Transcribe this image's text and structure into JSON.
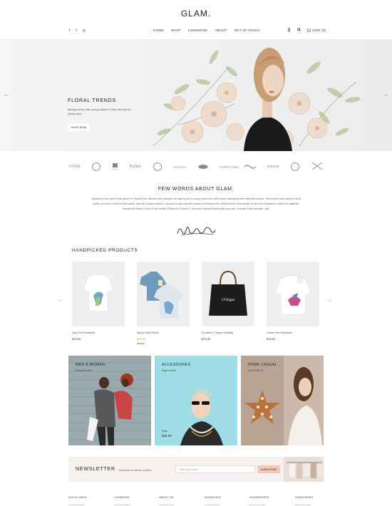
{
  "brand": {
    "logo": "GLAM."
  },
  "social": [
    {
      "icon": "facebook-icon",
      "glyph": "f"
    },
    {
      "icon": "twitter-icon",
      "glyph": "t"
    },
    {
      "icon": "instagram-icon",
      "glyph": "◎"
    }
  ],
  "nav": [
    "HOME",
    "SHOP",
    "LOOKBOOK",
    "ABOUT",
    "GET IN TOUCH"
  ],
  "header_icons": {
    "user_icon": "user-icon",
    "search_icon": "search-icon",
    "cart_label": "CART (0)"
  },
  "hero": {
    "title": "FLORAL TRENDS",
    "text": "Boutique at the 19th-century cloister in Paris' left bank for Spring show",
    "button": "SHOP NOW",
    "prev": "←",
    "next": "→"
  },
  "brands": [
    "FORM",
    "",
    "Alva",
    "foxter",
    "",
    "PAPERS",
    "",
    "PORTLAND",
    "",
    "moose",
    "",
    ""
  ],
  "about": {
    "title": "FEW WORDS ABOUT GLAM.",
    "text": "Optimism is the name of the game for Resort 2016. Almost every designer we saw turned to sunny colors and outfit whose calculating their millennial lineups. There were many spins on floral prints, punches of '80s-era lime green, and lots of glam touches. Occasion to also say this season at Christian Dior, Maria Grazia Chiuri swept us off to the Southwest, while Karl Lagerfeld brought the Resort Cruise to the middle of Paris for Chanel 17 and when the lead Aussie gets you over, consider those beautiful, wild.",
    "signature": "Nella Stayner"
  },
  "products": {
    "title": "HANDPICKED PRODUCTS",
    "prev": "←",
    "next": "→",
    "items": [
      {
        "name": "Dog-Print Sweatshirt",
        "price": "$78.00",
        "old_price": ""
      },
      {
        "name": "Spring Green Wave",
        "price": "$48.00",
        "old_price": "$58.00"
      },
      {
        "name": "Exclusive L'Origan Handbag",
        "price": "$79.00",
        "old_price": ""
      },
      {
        "name": "Goose Print Sweatshirt",
        "price": "$78.00",
        "old_price": ""
      }
    ]
  },
  "categories": [
    {
      "title": "MEN & WOMEN",
      "sub": "Summer outfit",
      "from": "",
      "price": ""
    },
    {
      "title": "ACCESSORIES",
      "sub": "Huge choice",
      "from": "From",
      "price": "$25.00"
    },
    {
      "title": "HOME CASUAL",
      "sub": "Up to 30% off",
      "from": "",
      "price": ""
    }
  ],
  "newsletter": {
    "title": "NEWSLETTER",
    "text": "Subscribe to receive updates",
    "placeholder": "Enter your email",
    "button": "SUBSCRIBE"
  },
  "footer": [
    "QUICK LINKS",
    "LOOKBOOK",
    "ABOUT US",
    "VACANCIES",
    "GUARANTEES",
    "CATEGORIES"
  ],
  "colors": {
    "accent": "#f2c9b4",
    "sale": "#d4a017",
    "newsletter_bg": "#f6f1ee"
  }
}
